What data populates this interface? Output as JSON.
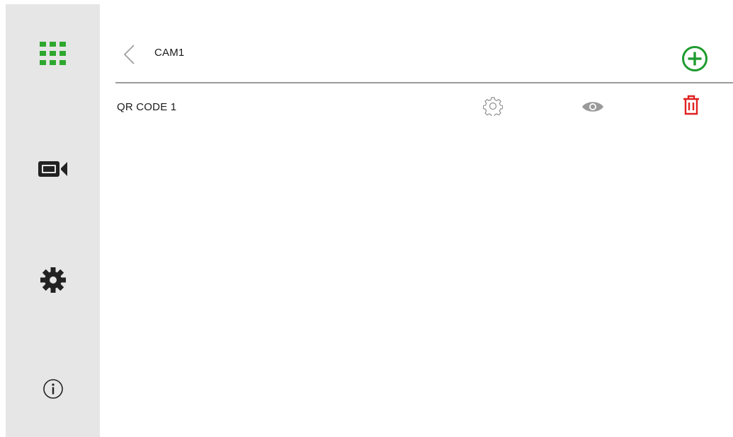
{
  "sidebar": {
    "items": [
      {
        "icon": "grid-icon",
        "color": "#2ea82e"
      },
      {
        "icon": "camera-icon",
        "color": "#222222"
      },
      {
        "icon": "gear-icon",
        "color": "#222222"
      },
      {
        "icon": "info-icon",
        "color": "#222222"
      }
    ]
  },
  "header": {
    "title": "CAM1",
    "back_icon": "chevron-left-icon",
    "add_icon": "add-circle-icon",
    "add_color": "#1e9b2e"
  },
  "list": {
    "rows": [
      {
        "label": "QR CODE 1",
        "settings_icon": "settings-icon",
        "view_icon": "eye-icon",
        "delete_icon": "trash-icon",
        "delete_color": "#e02020"
      }
    ]
  }
}
